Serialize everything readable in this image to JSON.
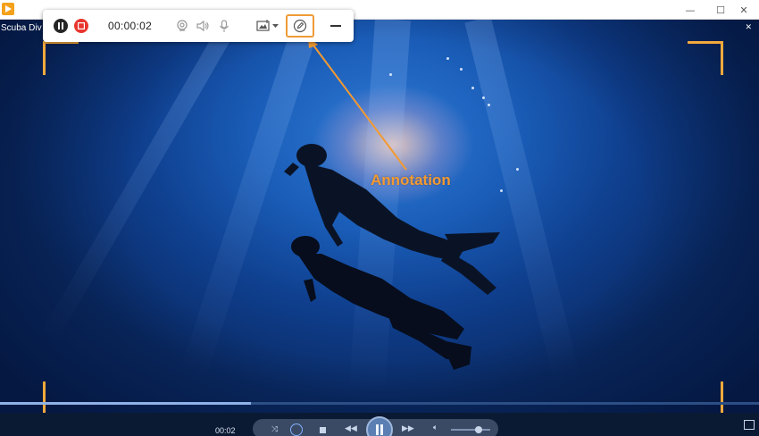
{
  "window": {
    "video_title": "Scuba Diving",
    "minimize_glyph": "—",
    "maximize_glyph": "☐",
    "close_glyph": "✕",
    "corner_glyph": "✕"
  },
  "recorder": {
    "timer": "00:00:02",
    "icons": [
      "pause-icon",
      "stop-icon",
      "webcam-icon",
      "speaker-icon",
      "microphone-icon",
      "screenshot-icon",
      "dropdown-icon",
      "annotation-icon",
      "minimize-icon"
    ],
    "accent_color": "#ee9b37",
    "stop_color": "#e8352e"
  },
  "callout": {
    "label": "Annotation"
  },
  "player": {
    "elapsed": "00:02",
    "progress_fraction": 0.33,
    "volume_fraction": 0.7,
    "icons": [
      "shuffle-icon",
      "repeat-icon",
      "stop-icon",
      "rewind-icon",
      "play-pause-icon",
      "fast-forward-icon",
      "volume-icon",
      "fullscreen-icon"
    ]
  }
}
